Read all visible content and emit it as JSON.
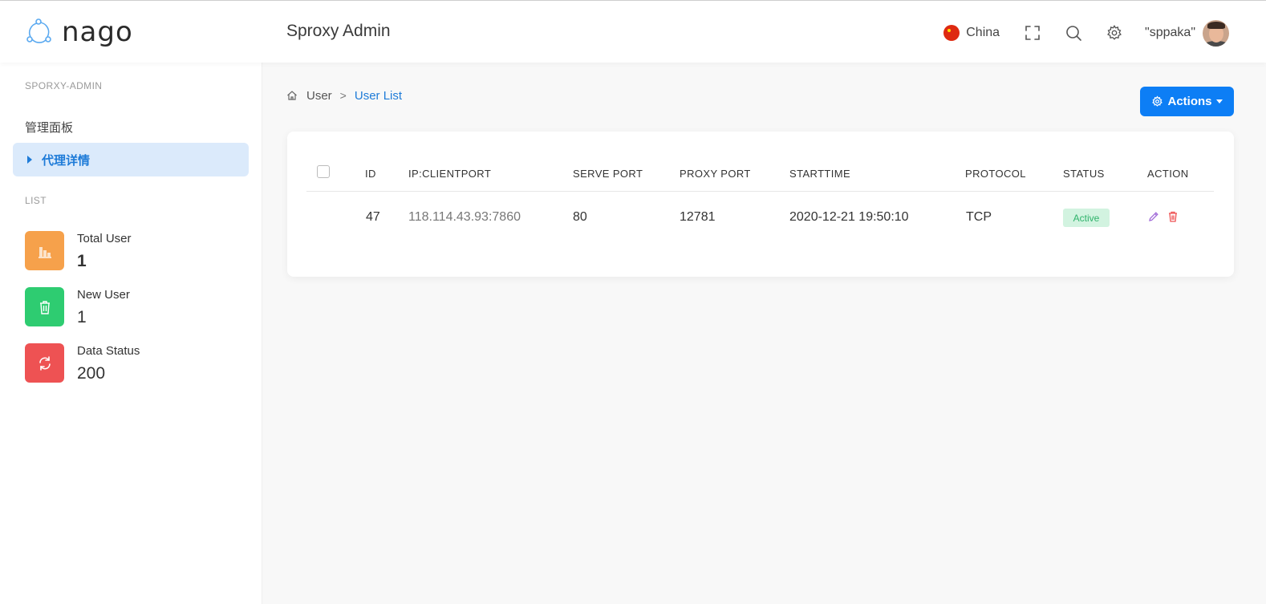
{
  "header": {
    "brand": "nago",
    "title": "Sproxy Admin",
    "language": "China",
    "user": "\"sppaka\""
  },
  "sidebar": {
    "section_title": "SPORXY-ADMIN",
    "dashboard": "管理面板",
    "active_item": "代理详情",
    "list_title": "LIST",
    "stats": [
      {
        "label": "Total User",
        "value": "1",
        "color": "#f6a14b",
        "icon": "bar-chart-icon"
      },
      {
        "label": "New User",
        "value": "1",
        "color": "#2ecc71",
        "icon": "trash-icon"
      },
      {
        "label": "Data Status",
        "value": "200",
        "color": "#ee5253",
        "icon": "refresh-icon"
      }
    ]
  },
  "breadcrumb": {
    "parent": "User",
    "current": "User List"
  },
  "actions_label": "Actions",
  "table": {
    "headers": [
      "ID",
      "IP:CLIENTPORT",
      "SERVE PORT",
      "PROXY PORT",
      "STARTTIME",
      "PROTOCOL",
      "STATUS",
      "ACTION"
    ],
    "rows": [
      {
        "id": "47",
        "ip": "118.114.43.93:7860",
        "serve_port": "80",
        "proxy_port": "12781",
        "starttime": "2020-12-21 19:50:10",
        "protocol": "TCP",
        "status": "Active"
      }
    ]
  },
  "colors": {
    "accent": "#0d7ef5",
    "active_badge_bg": "#d2f3e0",
    "active_badge_text": "#2fb36b"
  }
}
